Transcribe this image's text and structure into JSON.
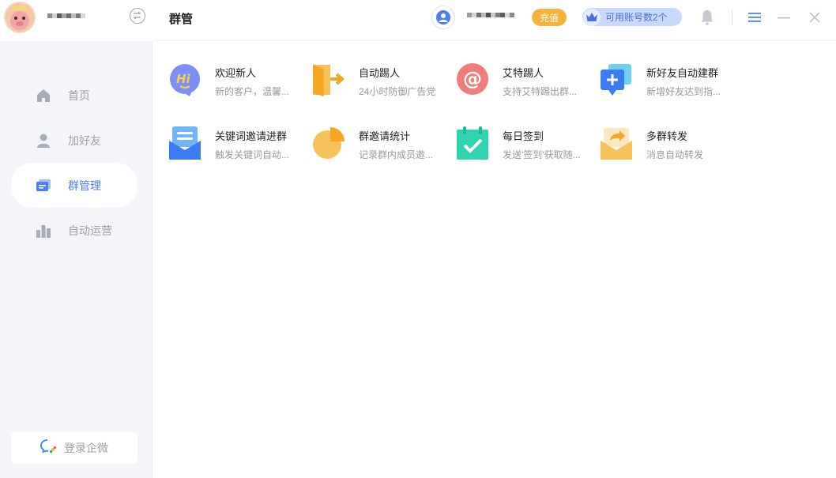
{
  "sidebar": {
    "nav": [
      {
        "label": "首页",
        "icon": "home-icon"
      },
      {
        "label": "加好友",
        "icon": "user-icon"
      },
      {
        "label": "群管理",
        "icon": "group-manage-icon",
        "active": true
      },
      {
        "label": "自动运营",
        "icon": "bar-chart-icon"
      }
    ],
    "login_label": "登录企微"
  },
  "header": {
    "title": "群管",
    "recharge_label": "充值",
    "accounts_label": "可用账号数2个"
  },
  "features": [
    {
      "title": "欢迎新人",
      "desc": "新的客户，温馨...",
      "icon": "hi-chat-icon",
      "color": "#7d8ef6"
    },
    {
      "title": "自动踢人",
      "desc": "24小时防御广告党",
      "icon": "exit-door-icon",
      "color": "#f5b33b"
    },
    {
      "title": "艾特踢人",
      "desc": "支持艾特踢出群...",
      "icon": "at-sign-icon",
      "color": "#f07c7c"
    },
    {
      "title": "新好友自动建群",
      "desc": "新增好友达到指...",
      "icon": "add-group-icon",
      "color": "#4d8ef7"
    },
    {
      "title": "关键词邀请进群",
      "desc": "触发关键词自动...",
      "icon": "keyword-mail-icon",
      "color": "#4d8ef7"
    },
    {
      "title": "群邀请统计",
      "desc": "记录群内成员邀...",
      "icon": "pie-chart-icon",
      "color": "#f5b33b"
    },
    {
      "title": "每日签到",
      "desc": "发送'签到'获取随...",
      "icon": "calendar-check-icon",
      "color": "#2fd3b0"
    },
    {
      "title": "多群转发",
      "desc": "消息自动转发",
      "icon": "forward-mail-icon",
      "color": "#f7c15a"
    }
  ],
  "colors": {
    "accent": "#4d7ef7",
    "recharge": "#f5b33b",
    "sidebar_bg": "#f4f5f8"
  }
}
